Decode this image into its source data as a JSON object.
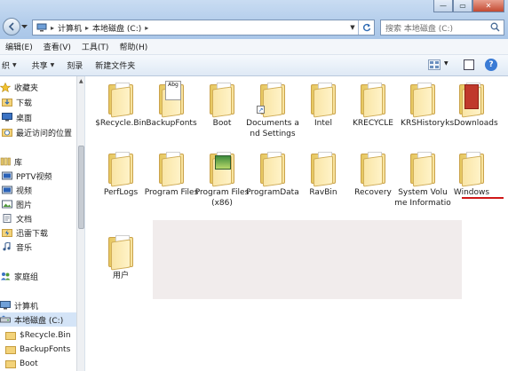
{
  "window": {
    "minimize_glyph": "—",
    "maximize_glyph": "▭",
    "close_glyph": "✕"
  },
  "address": {
    "segments": [
      "计算机",
      "本地磁盘 (C:)"
    ],
    "separator": "▸"
  },
  "search": {
    "placeholder": "搜索 本地磁盘 (C:)"
  },
  "menu": {
    "items": [
      "编辑(E)",
      "查看(V)",
      "工具(T)",
      "帮助(H)"
    ]
  },
  "toolbar": {
    "organize": "织",
    "share": "共享",
    "burn": "刻录",
    "new_folder": "新建文件夹",
    "help": "?"
  },
  "sidebar": {
    "favorites": "收藏夹",
    "downloads": "下载",
    "desktop": "桌面",
    "recent": "最近访问的位置",
    "libraries": "库",
    "pptv": "PPTV视频",
    "videos": "视频",
    "pictures": "图片",
    "documents": "文档",
    "thunder": "迅雷下载",
    "music": "音乐",
    "homegroup": "家庭组",
    "computer": "计算机",
    "local_disk": "本地磁盘 (C:)",
    "recycle": "$Recycle.Bin",
    "backupfonts": "BackupFonts",
    "boot": "Boot"
  },
  "files": [
    {
      "name": "$Recycle.Bin",
      "type": "folder"
    },
    {
      "name": "BackupFonts",
      "type": "folder-doc",
      "badge": "Abg"
    },
    {
      "name": "Boot",
      "type": "folder"
    },
    {
      "name": "Documents and Settings",
      "type": "folder-shortcut"
    },
    {
      "name": "Intel",
      "type": "folder"
    },
    {
      "name": "KRECYCLE",
      "type": "folder"
    },
    {
      "name": "KRSHistory",
      "type": "folder"
    },
    {
      "name": "ksDownloads",
      "type": "folder-red"
    },
    {
      "name": "PerfLogs",
      "type": "folder"
    },
    {
      "name": "Program Files",
      "type": "folder"
    },
    {
      "name": "Program Files (x86)",
      "type": "folder-img"
    },
    {
      "name": "ProgramData",
      "type": "folder"
    },
    {
      "name": "RavBin",
      "type": "folder"
    },
    {
      "name": "Recovery",
      "type": "folder"
    },
    {
      "name": "System Volume Informatio",
      "type": "folder"
    },
    {
      "name": "Windows",
      "type": "folder",
      "highlighted": true
    },
    {
      "name": "用户",
      "type": "folder"
    }
  ],
  "colors": {
    "highlight_underline": "#d01818",
    "folder": "#f3d37a",
    "selection": "#d4e4f7"
  }
}
